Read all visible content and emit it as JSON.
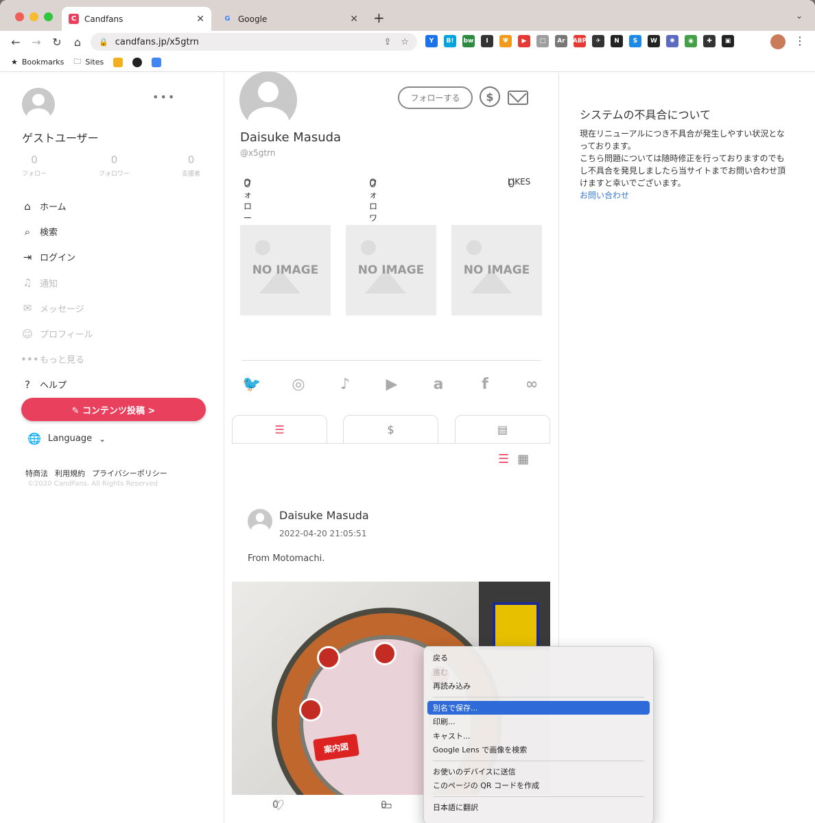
{
  "browser": {
    "tabs": [
      {
        "title": "Candfans",
        "active": true
      },
      {
        "title": "Google",
        "active": false
      }
    ],
    "new_tab": "+",
    "tab_menu": "⌄",
    "url": "candfans.jp/x5gtrn",
    "bookmarks": [
      {
        "label": "Bookmarks",
        "icon": "star-icon"
      },
      {
        "label": "Sites",
        "icon": "folder-icon"
      }
    ],
    "extensions": [
      {
        "label": "Y",
        "color": "#1a73e8"
      },
      {
        "label": "B!",
        "color": "#00a4de"
      },
      {
        "label": "bw",
        "color": "#2b8a3e"
      },
      {
        "label": "I",
        "color": "#333333"
      },
      {
        "label": "Ψ",
        "color": "#f29a1d"
      },
      {
        "label": "▶",
        "color": "#e53935"
      },
      {
        "label": "□",
        "color": "#9e9e9e"
      },
      {
        "label": "Ar",
        "color": "#777777"
      },
      {
        "label": "ABP",
        "color": "#e53935"
      },
      {
        "label": "✈",
        "color": "#333333"
      },
      {
        "label": "N",
        "color": "#222222"
      },
      {
        "label": "S",
        "color": "#1e88e5"
      },
      {
        "label": "W",
        "color": "#222222"
      },
      {
        "label": "✺",
        "color": "#5c6bc0"
      },
      {
        "label": "◉",
        "color": "#43a047"
      },
      {
        "label": "✚",
        "color": "#333333"
      },
      {
        "label": "▣",
        "color": "#222222"
      }
    ]
  },
  "sidebar": {
    "more": "•••",
    "user_name": "ゲストユーザー",
    "stats": [
      {
        "value": "0",
        "label": "フォロー"
      },
      {
        "value": "0",
        "label": "フォロワー"
      },
      {
        "value": "0",
        "label": "支援者"
      }
    ],
    "menu": [
      {
        "label": "ホーム",
        "icon": "⌂",
        "name": "home",
        "dim": false
      },
      {
        "label": "検索",
        "icon": "⌕",
        "name": "search",
        "dim": false
      },
      {
        "label": "ログイン",
        "icon": "⇥",
        "name": "login",
        "dim": false
      },
      {
        "label": "通知",
        "icon": "♫",
        "name": "notification",
        "dim": true
      },
      {
        "label": "メッセージ",
        "icon": "✉",
        "name": "message",
        "dim": true
      },
      {
        "label": "プロフィール",
        "icon": "☺",
        "name": "profile",
        "dim": true
      },
      {
        "label": "もっと見る",
        "icon": "•••",
        "name": "more",
        "dim": true
      },
      {
        "label": "ヘルプ",
        "icon": "?",
        "name": "help",
        "dim": false
      }
    ],
    "post_button": "✎ コンテンツ投稿 >",
    "language": "Language",
    "footer_links": [
      "特商法",
      "利用規約",
      "プライバシーポリシー"
    ],
    "copyright": "©2020 CandFans. All Rights Reserved"
  },
  "profile": {
    "follow_button": "フォローする",
    "name": "Daisuke Masuda",
    "handle": "@x5gtrn",
    "stats": [
      {
        "value": "0",
        "label": "フォロー"
      },
      {
        "value": "0",
        "label": "フォロワー"
      },
      {
        "value": "0",
        "label": "LIKES"
      }
    ],
    "no_image_label": "NO IMAGE",
    "social": [
      {
        "glyph": "🐦",
        "name": "twitter"
      },
      {
        "glyph": "◎",
        "name": "instagram"
      },
      {
        "glyph": "♪",
        "name": "tiktok"
      },
      {
        "glyph": "▶",
        "name": "youtube"
      },
      {
        "glyph": "a",
        "name": "amazon"
      },
      {
        "glyph": "f",
        "name": "facebook"
      },
      {
        "glyph": "∞",
        "name": "link"
      }
    ],
    "tabs": [
      {
        "glyph": "☰",
        "name": "list"
      },
      {
        "glyph": "$",
        "name": "paid"
      },
      {
        "glyph": "▤",
        "name": "folder"
      }
    ],
    "views": [
      {
        "glyph": "☰",
        "name": "list-view"
      },
      {
        "glyph": "▦",
        "name": "grid-view"
      }
    ]
  },
  "post": {
    "author": "Daisuke Masuda",
    "date": "2022-04-20 21:05:51",
    "text": "From Motomachi.",
    "sign": "案内図",
    "likes": "0",
    "comments": "0"
  },
  "notice": {
    "title": "システムの不具合について",
    "body": "現在リニューアルにつき不具合が発生しやすい状況となっております。\nこちら問題については随時修正を行っておりますのでもし不具合を発見しましたら当サイトまでお問い合わせ頂けますと幸いでございます。",
    "link": "お問い合わせ"
  },
  "context_menu": {
    "groups": [
      [
        {
          "label": "戻る",
          "disabled": false,
          "selected": false
        },
        {
          "label": "進む",
          "disabled": true,
          "selected": false
        },
        {
          "label": "再読み込み",
          "disabled": false,
          "selected": false
        }
      ],
      [
        {
          "label": "別名で保存...",
          "disabled": false,
          "selected": true
        },
        {
          "label": "印刷...",
          "disabled": false,
          "selected": false
        },
        {
          "label": "キャスト...",
          "disabled": false,
          "selected": false
        },
        {
          "label": "Google Lens で画像を検索",
          "disabled": false,
          "selected": false
        }
      ],
      [
        {
          "label": "お使いのデバイスに送信",
          "disabled": false,
          "selected": false
        },
        {
          "label": "このページの QR コードを作成",
          "disabled": false,
          "selected": false
        }
      ],
      [
        {
          "label": "日本語に翻訳",
          "disabled": false,
          "selected": false
        }
      ]
    ]
  },
  "colors": {
    "accent": "#e8405d",
    "link": "#3a7bd5",
    "selected": "#2f6bd8"
  }
}
